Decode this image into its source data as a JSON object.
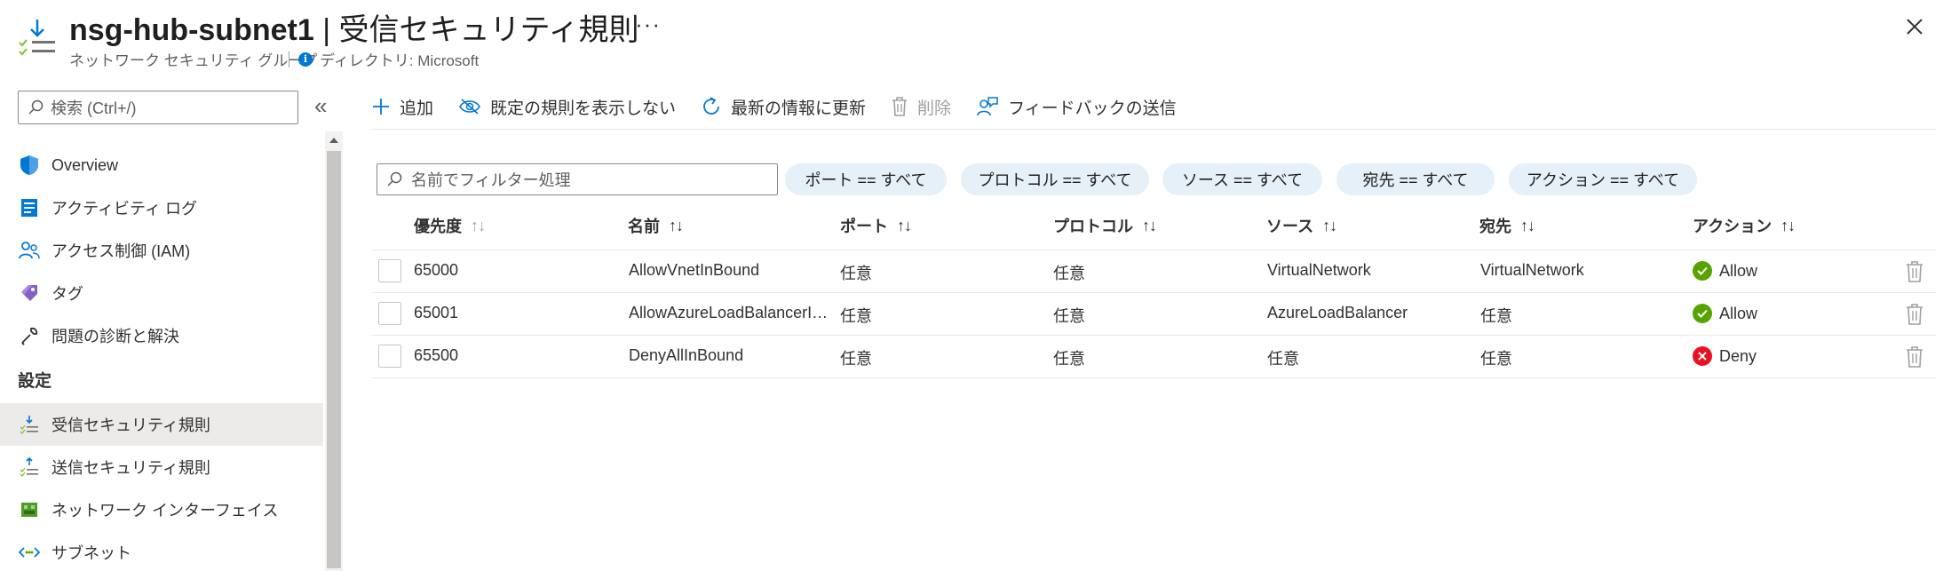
{
  "header": {
    "title_name": "nsg-hub-subnet1",
    "title_sep": " | ",
    "title_page": "受信セキュリティ規則",
    "more": "···",
    "subtitle": "ネットワーク セキュリティ グループ",
    "directory": "ディレクトリ: Microsoft",
    "resource_icon": "inbound-rules-icon",
    "close_icon": "close-icon"
  },
  "sidebar": {
    "search_placeholder": "検索 (Ctrl+/)",
    "collapse": "«",
    "items": [
      {
        "label": "Overview",
        "icon": "shield-icon"
      },
      {
        "label": "アクティビティ ログ",
        "icon": "activity-log-icon"
      },
      {
        "label": "アクセス制御 (IAM)",
        "icon": "people-icon"
      },
      {
        "label": "タグ",
        "icon": "tag-icon"
      },
      {
        "label": "問題の診断と解決",
        "icon": "wrench-icon"
      }
    ],
    "section": "設定",
    "settings_items": [
      {
        "label": "受信セキュリティ規則",
        "icon": "inbound-rules-icon",
        "selected": true
      },
      {
        "label": "送信セキュリティ規則",
        "icon": "outbound-rules-icon"
      },
      {
        "label": "ネットワーク インターフェイス",
        "icon": "network-interface-icon"
      },
      {
        "label": "サブネット",
        "icon": "subnet-icon"
      }
    ]
  },
  "toolbar": {
    "add": "追加",
    "hide_default": "既定の規則を表示しない",
    "refresh": "最新の情報に更新",
    "delete": "削除",
    "feedback": "フィードバックの送信"
  },
  "filter": {
    "placeholder": "名前でフィルター処理",
    "pills": [
      "ポート == すべて",
      "プロトコル == すべて",
      "ソース == すべて",
      "宛先 == すべて",
      "アクション == すべて"
    ]
  },
  "table": {
    "columns": [
      "優先度",
      "名前",
      "ポート",
      "プロトコル",
      "ソース",
      "宛先",
      "アクション"
    ],
    "sort_glyph": "↑↓",
    "rows": [
      {
        "priority": "65000",
        "name": "AllowVnetInBound",
        "port": "任意",
        "protocol": "任意",
        "source": "VirtualNetwork",
        "destination": "VirtualNetwork",
        "action": "Allow"
      },
      {
        "priority": "65001",
        "name": "AllowAzureLoadBalancerInBound",
        "port": "任意",
        "protocol": "任意",
        "source": "AzureLoadBalancer",
        "destination": "任意",
        "action": "Allow"
      },
      {
        "priority": "65500",
        "name": "DenyAllInBound",
        "port": "任意",
        "protocol": "任意",
        "source": "任意",
        "destination": "任意",
        "action": "Deny"
      }
    ]
  },
  "colors": {
    "accent": "#0078d4",
    "allow": "#57a300",
    "deny": "#e81123",
    "pill_bg": "#e6f0f9",
    "selected_bg": "#edebe9"
  }
}
